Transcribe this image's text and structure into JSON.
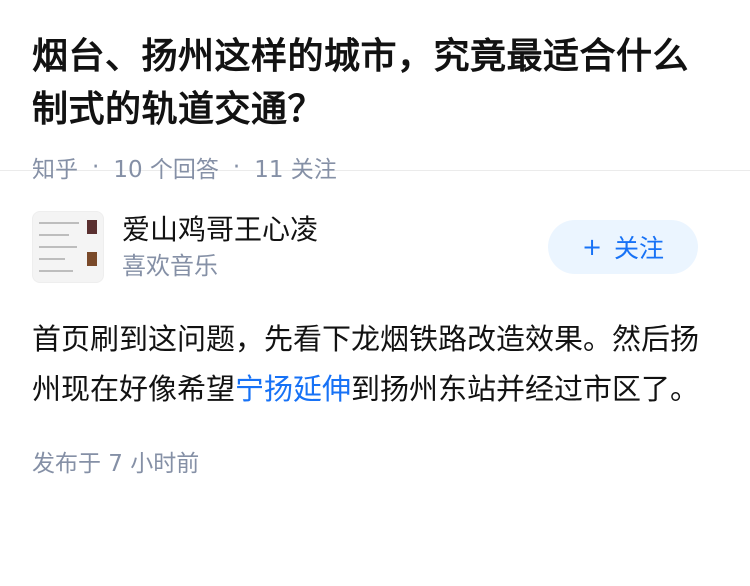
{
  "question": {
    "title": "烟台、扬州这样的城市，究竟最适合什么制式的轨道交通？",
    "source": "知乎",
    "answers": "10 个回答",
    "followers": "11 关注"
  },
  "answer": {
    "author_name": "爱山鸡哥王心凌",
    "author_bio": "喜欢音乐",
    "follow_plus": "+",
    "follow_label": "关注",
    "text_before": "首页刷到这问题，先看下龙烟铁路改造效果。然后扬州现在好像希望",
    "link_text": "宁扬延伸",
    "text_after": "到扬州东站并经过市区了。",
    "published": "发布于 7 小时前"
  },
  "colors": {
    "link": "#1772f6",
    "meta": "#8590a6",
    "follow_bg": "#ebf5ff"
  }
}
